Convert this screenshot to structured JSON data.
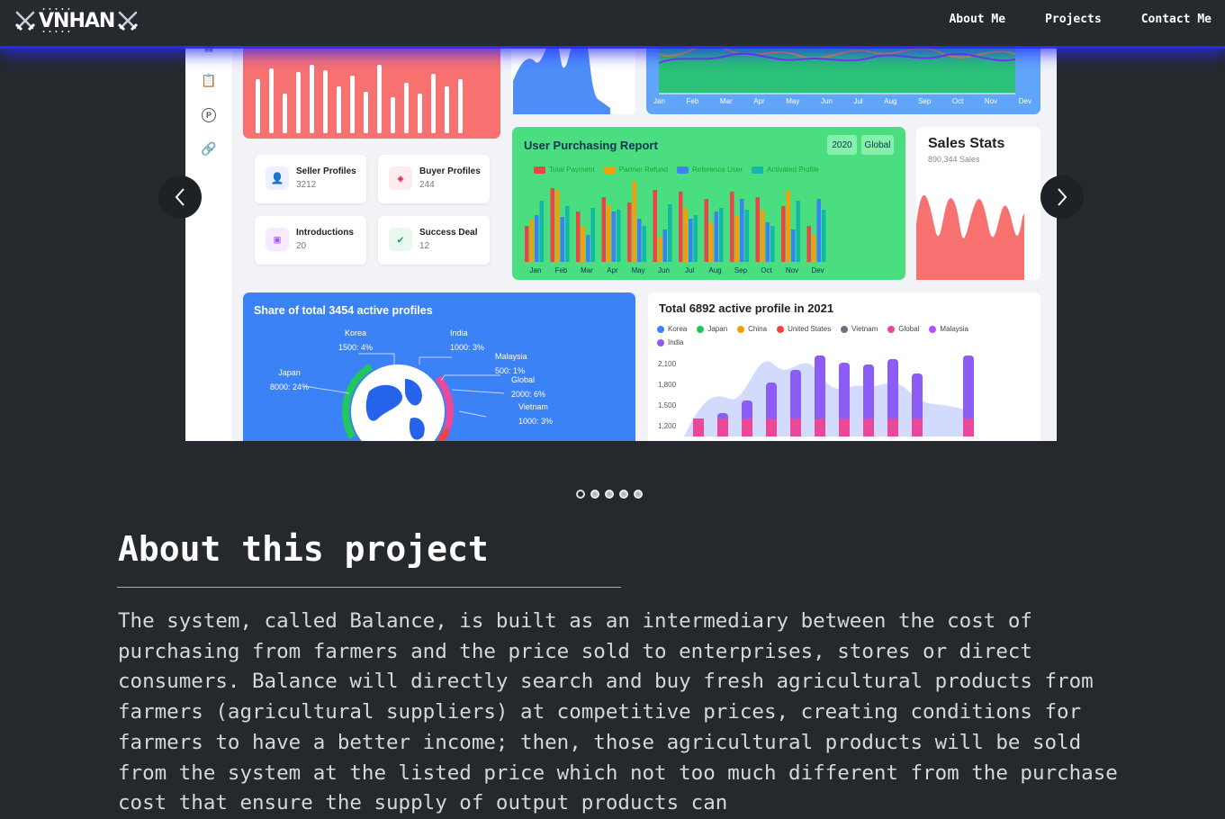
{
  "brand": {
    "name": "VNHAN"
  },
  "nav": {
    "items": [
      {
        "label": "About Me"
      },
      {
        "label": "Projects"
      },
      {
        "label": "Contact Me"
      }
    ]
  },
  "carousel": {
    "slide_count": 5,
    "active_index": 0,
    "slide": {
      "sidebar_icons": [
        "layout-icon",
        "clipboard-icon",
        "parking-icon",
        "link-icon"
      ],
      "purchasing": {
        "title": "User Purchasing Report",
        "year_button": "2020",
        "scope_button": "Global",
        "months": [
          "Jan",
          "Feb",
          "Mar",
          "Apr",
          "May",
          "Jun",
          "Jul",
          "Aug",
          "Sep",
          "Oct",
          "Nov",
          "Dev"
        ],
        "legend": [
          "Total Payment",
          "Partner Refund",
          "Reference User",
          "Activated Profile"
        ]
      },
      "top_months": [
        "Jan",
        "Feb",
        "Mar",
        "Apr",
        "May",
        "Jun",
        "Jul",
        "Aug",
        "Sep",
        "Oct",
        "Nov",
        "Dev"
      ],
      "profile_cards": [
        {
          "label": "Seller Profiles",
          "value": "3212",
          "icon": "user-icon"
        },
        {
          "label": "Buyer Profiles",
          "value": "244",
          "icon": "gem-icon"
        },
        {
          "label": "Introductions",
          "value": "20",
          "icon": "briefcase-icon"
        },
        {
          "label": "Success Deal",
          "value": "12",
          "icon": "check-circle-icon"
        }
      ],
      "sales": {
        "title": "Sales Stats",
        "subtitle": "890,344 Sales"
      },
      "share": {
        "title": "Share of total 3454 active profiles",
        "labels": [
          {
            "name": "Korea",
            "value": "1500: 4%"
          },
          {
            "name": "India",
            "value": "1000: 3%"
          },
          {
            "name": "Malaysia",
            "value": "500: 1%"
          },
          {
            "name": "Global",
            "value": "2000: 6%"
          },
          {
            "name": "Vietnam",
            "value": "1000: 3%"
          },
          {
            "name": "Japan",
            "value": "8000: 24%"
          }
        ]
      },
      "total": {
        "title": "Total 6892 active profile in 2021",
        "legend": [
          "Korea",
          "Japan",
          "China",
          "United States",
          "Vietnam",
          "Global",
          "Malaysia",
          "India"
        ],
        "y_ticks": [
          "2,100",
          "1,800",
          "1,500",
          "1,200"
        ]
      }
    }
  },
  "about": {
    "heading": "About this project",
    "paragraph": "The system, called Balance, is built as an intermediary between the cost of purchasing from farmers and the price sold to enterprises, stores or direct consumers. Balance will directly search and buy fresh agricultural products from farmers (agricultural suppliers) at competitive prices, creating conditions for farmers to have a better income; then, those agricultural products will be sold from the system at the listed price which not too much different from the purchase cost that ensure the supply of output products can"
  },
  "colors": {
    "accent_glow": "#2828ff",
    "background": "#25292e",
    "purchasing_card": "#4ade80",
    "top_left_card": "#f87171",
    "share_card": "#3b82f6",
    "legend": [
      "#ef4444",
      "#f59e0b",
      "#3b82f6",
      "#14b8a6"
    ],
    "total_legend": [
      "#3b82f6",
      "#22c55e",
      "#f59e0b",
      "#ef4444",
      "#6b7280",
      "#ec4899",
      "#a855f7",
      "#8b5cf6"
    ]
  }
}
